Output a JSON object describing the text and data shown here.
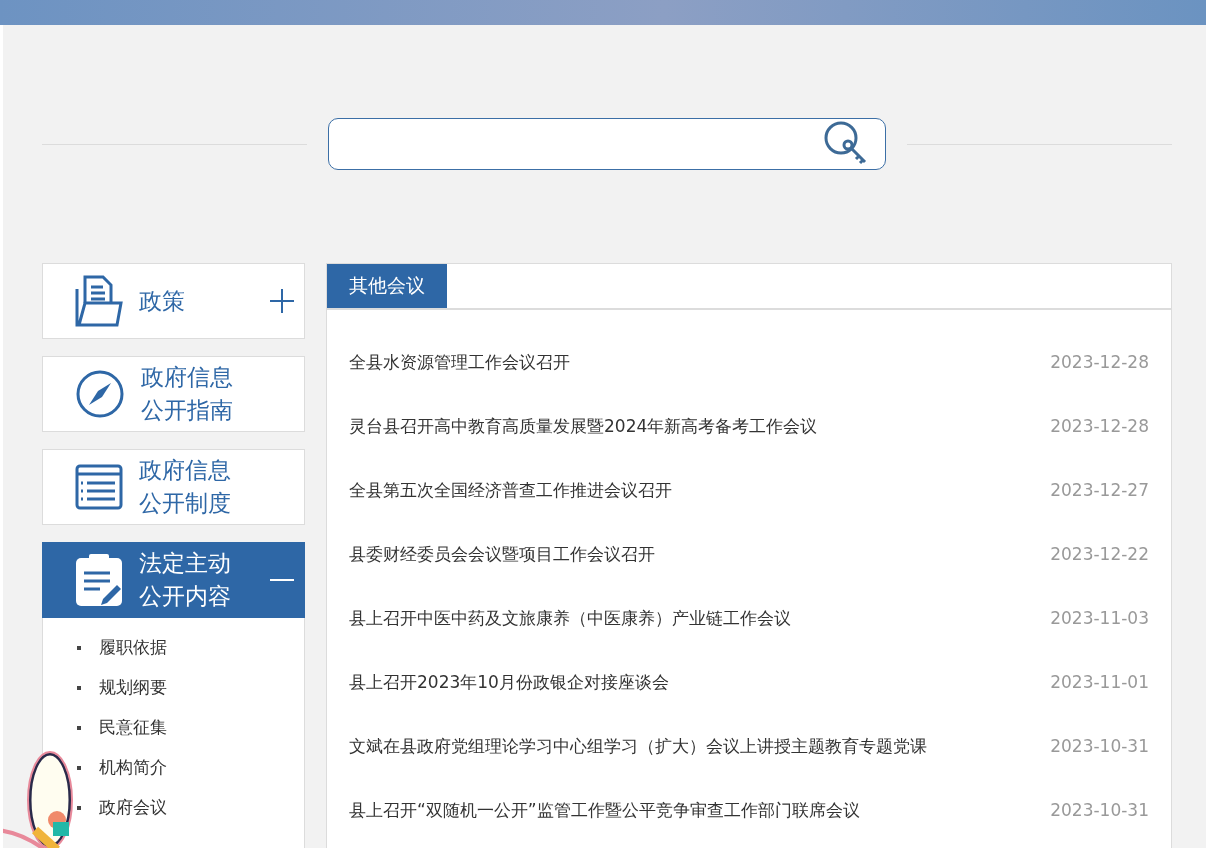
{
  "sidebar": {
    "items": [
      {
        "label": "政策",
        "expanded": false
      },
      {
        "label": "政府信息公开指南"
      },
      {
        "label": "政府信息公开制度"
      },
      {
        "label": "法定主动公开内容",
        "expanded": true,
        "children": [
          "履职依据",
          "规划纲要",
          "民意征集",
          "机构简介",
          "政府会议"
        ]
      }
    ]
  },
  "panel": {
    "tab": "其他会议",
    "rows": [
      {
        "title": "全县水资源管理工作会议召开",
        "date": "2023-12-28"
      },
      {
        "title": "灵台县召开高中教育高质量发展暨2024年新高考备考工作会议",
        "date": "2023-12-28"
      },
      {
        "title": "全县第五次全国经济普查工作推进会议召开",
        "date": "2023-12-27"
      },
      {
        "title": "县委财经委员会会议暨项目工作会议召开",
        "date": "2023-12-22"
      },
      {
        "title": "县上召开中医中药及文旅康养（中医康养）产业链工作会议",
        "date": "2023-11-03"
      },
      {
        "title": "县上召开2023年10月份政银企对接座谈会",
        "date": "2023-11-01"
      },
      {
        "title": "文斌在县政府党组理论学习中心组学习（扩大）会议上讲授主题教育专题党课",
        "date": "2023-10-31"
      },
      {
        "title": "县上召开“双随机一公开”监管工作暨公平竞争审查工作部门联席会议",
        "date": "2023-10-31"
      }
    ]
  }
}
